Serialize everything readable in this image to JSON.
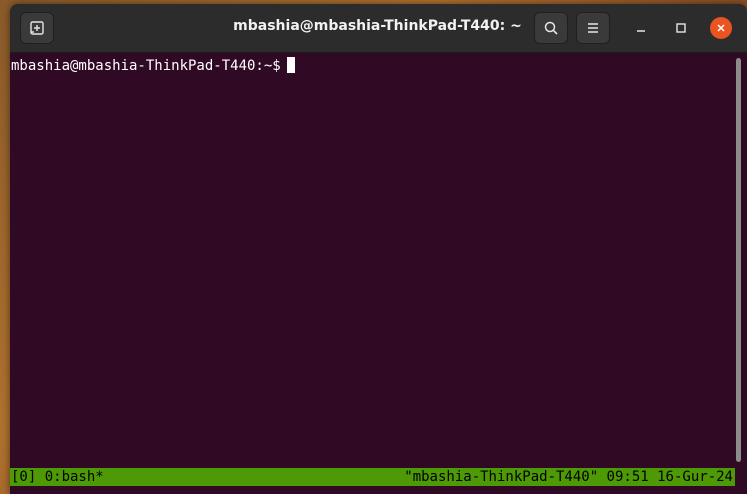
{
  "window": {
    "title": "mbashia@mbashia-ThinkPad-T440: ~",
    "accent_close_color": "#e95420",
    "terminal_background": "#300a24"
  },
  "titlebar": {
    "new_tab_icon": "new-tab-icon",
    "search_icon": "search-icon",
    "menu_icon": "hamburger-menu-icon",
    "minimize_icon": "minimize-icon",
    "maximize_icon": "maximize-icon",
    "close_icon": "close-icon"
  },
  "terminal": {
    "prompt": "mbashia@mbashia-ThinkPad-T440:~$"
  },
  "tmux": {
    "status_color": "#4e9a06",
    "left": "[0] 0:bash*",
    "right": "\"mbashia-ThinkPad-T440\" 09:51 16-Gur-24"
  }
}
